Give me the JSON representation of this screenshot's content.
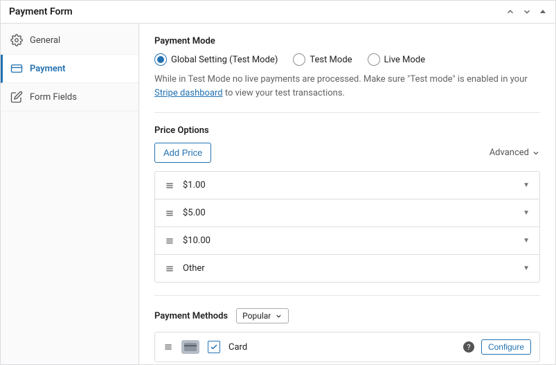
{
  "header": {
    "title": "Payment Form"
  },
  "sidebar": {
    "items": [
      {
        "label": "General"
      },
      {
        "label": "Payment"
      },
      {
        "label": "Form Fields"
      }
    ]
  },
  "payment_mode": {
    "title": "Payment Mode",
    "options": [
      {
        "label": "Global Setting (Test Mode)"
      },
      {
        "label": "Test Mode"
      },
      {
        "label": "Live Mode"
      }
    ],
    "help_prefix": "While in Test Mode no live payments are processed. Make sure \"Test mode\" is enabled in your ",
    "help_link": "Stripe dashboard",
    "help_suffix": " to view your test transactions."
  },
  "price_options": {
    "title": "Price Options",
    "add_label": "Add Price",
    "advanced_label": "Advanced",
    "items": [
      {
        "label": "$1.00"
      },
      {
        "label": "$5.00"
      },
      {
        "label": "$10.00"
      },
      {
        "label": "Other"
      }
    ]
  },
  "payment_methods": {
    "title": "Payment Methods",
    "filter": "Popular",
    "items": [
      {
        "label": "Card",
        "configure": "Configure"
      }
    ]
  }
}
